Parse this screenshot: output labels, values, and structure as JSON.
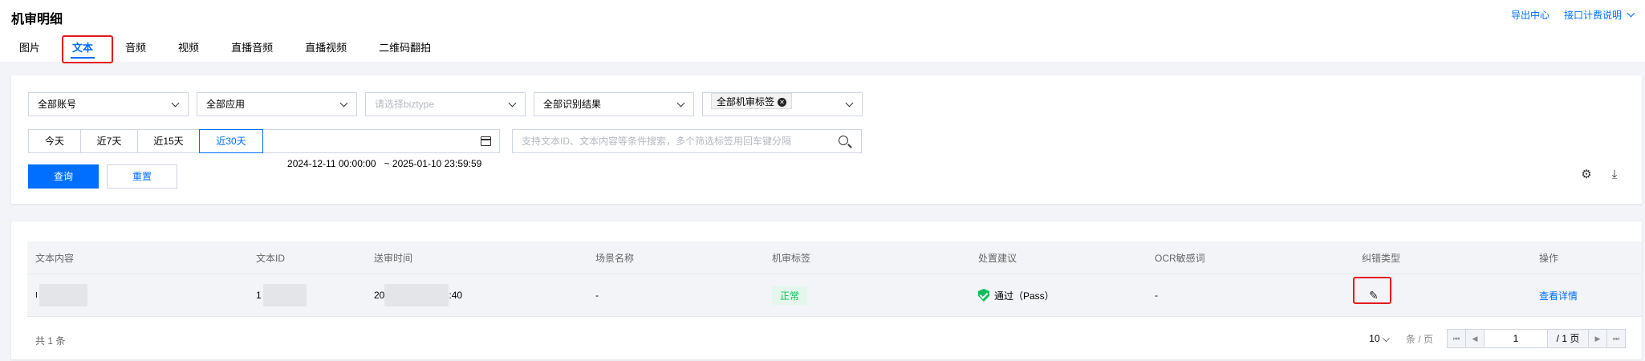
{
  "header": {
    "title": "机审明细",
    "links": [
      "导出中心",
      "接口计费说明"
    ]
  },
  "tabs": [
    "图片",
    "文本",
    "音频",
    "视频",
    "直播音频",
    "直播视频",
    "二维码翻拍"
  ],
  "active_tab": "文本",
  "filters": {
    "account": "全部账号",
    "app": "全部应用",
    "biztype_placeholder": "请选择biztype",
    "result": "全部识别结果",
    "label_chip": "全部机审标签",
    "time_ranges": [
      "今天",
      "近7天",
      "近15天",
      "近30天"
    ],
    "active_range": "近30天",
    "date_start": "2024-12-11 00:00:00",
    "date_end": "~ 2025-01-10 23:59:59",
    "search_placeholder": "支持文本ID、文本内容等条件搜索，多个筛选标签用回车键分隔",
    "query_label": "查询",
    "reset_label": "重置"
  },
  "table": {
    "columns": [
      "文本内容",
      "文本ID",
      "送审时间",
      "场景名称",
      "机审标签",
      "处置建议",
      "OCR敏感词",
      "纠错类型",
      "操作"
    ],
    "rows": [
      {
        "content": "I",
        "text_id": "1",
        "time_prefix": "20",
        "time_suffix": ":40",
        "scene": "-",
        "label": "正常",
        "suggestion": "通过（Pass）",
        "ocr": "-",
        "action": "查看详情"
      }
    ]
  },
  "footer": {
    "total": "共 1 条",
    "page_size": "10",
    "page_size_unit": "条 / 页",
    "current_page": "1",
    "total_pages": "/ 1 页"
  },
  "colors": {
    "accent": "#006eff",
    "success": "#0abf5b",
    "highlight": "#e31b1b"
  }
}
